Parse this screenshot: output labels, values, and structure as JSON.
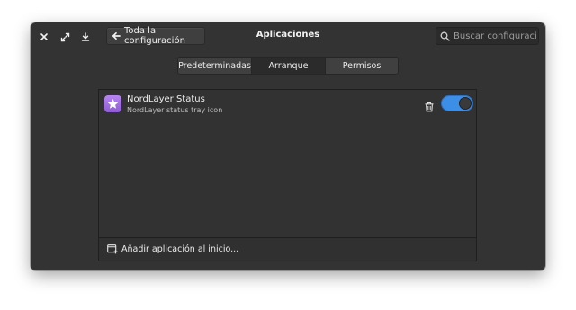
{
  "window": {
    "title": "Aplicaciones",
    "controls": [
      "close-icon",
      "maximize-icon",
      "download-icon"
    ]
  },
  "header": {
    "back_label": "Toda la configuración",
    "search": {
      "placeholder": "Buscar configuració...",
      "value": ""
    }
  },
  "tabs": [
    {
      "label": "Predeterminadas",
      "active": false
    },
    {
      "label": "Arranque",
      "active": true
    },
    {
      "label": "Permisos",
      "active": false
    }
  ],
  "startup_apps": [
    {
      "name": "NordLayer Status",
      "description": "NordLayer status tray icon",
      "icon": "star-icon",
      "enabled": true
    }
  ],
  "footer": {
    "add_label": "Añadir aplicación al inicio..."
  },
  "colors": {
    "window_bg": "#333333",
    "accent": "#3d8ee6",
    "app_icon": "#a46fe6"
  }
}
